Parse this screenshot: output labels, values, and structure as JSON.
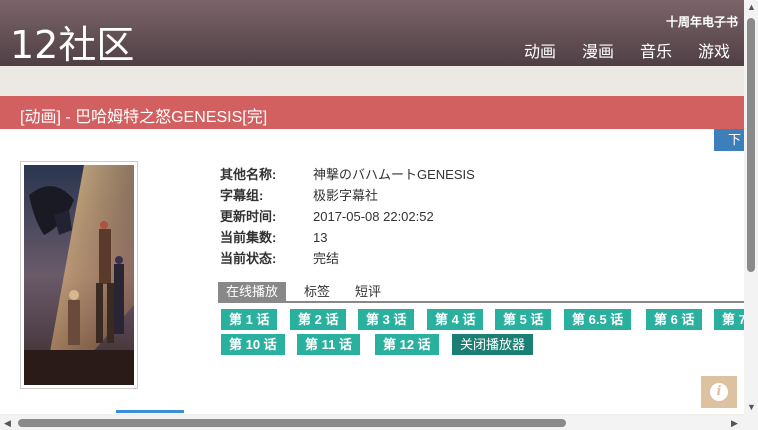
{
  "header": {
    "logo": "12社区",
    "top_link": "十周年电子书",
    "nav": [
      "动画",
      "漫画",
      "音乐",
      "游戏"
    ]
  },
  "title": "[动画] - 巴哈姆特之怒GENESIS[完]",
  "download_label": "下",
  "info": [
    {
      "label": "其他名称:",
      "value": "神撃のバハムートGENESIS"
    },
    {
      "label": "字幕组:",
      "value": "极影字幕社"
    },
    {
      "label": "更新时间:",
      "value": "2017-05-08 22:02:52"
    },
    {
      "label": "当前集数:",
      "value": "13"
    },
    {
      "label": "当前状态:",
      "value": "完结"
    }
  ],
  "tabs": [
    "在线播放",
    "标签",
    "短评"
  ],
  "episodes_row1": [
    "第 1 话",
    "第 2 话",
    "第 3 话",
    "第 4 话",
    "第 5 话",
    "第 6.5 话",
    "第 6 话",
    "第 7"
  ],
  "episodes_row2": [
    "第 10 话",
    "第 11 话",
    "第 12 话"
  ],
  "close_player": "关闭播放器",
  "colors": {
    "title_bar": "#d26060",
    "episode_button": "#2ab09f",
    "header": "#5f4d52"
  }
}
